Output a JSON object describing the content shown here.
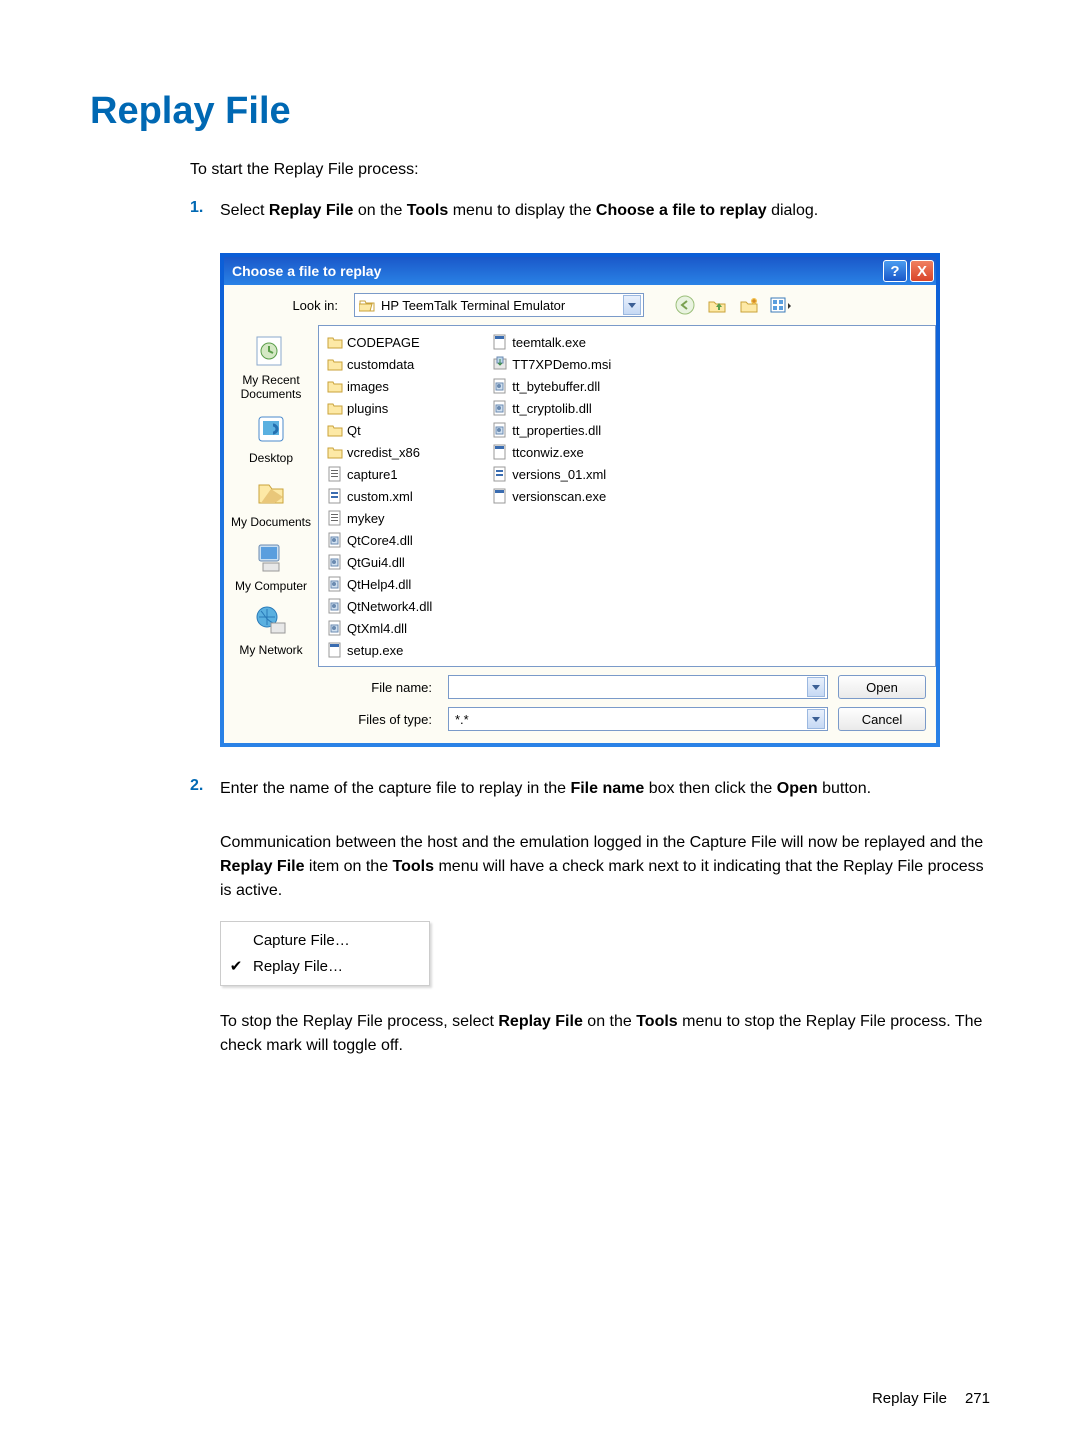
{
  "heading": "Replay File",
  "intro": "To start the Replay File process:",
  "step1": {
    "num": "1.",
    "pre": "Select ",
    "b1": "Replay File",
    "mid1": " on the ",
    "b2": "Tools",
    "mid2": " menu to display the ",
    "b3": "Choose a file to replay",
    "post": " dialog."
  },
  "dialog": {
    "title": "Choose a file to replay",
    "help": "?",
    "close": "X",
    "lookin_label": "Look in:",
    "lookin_value": "HP TeemTalk Terminal Emulator",
    "places": {
      "recent": "My Recent Documents",
      "desktop": "Desktop",
      "mydocs": "My Documents",
      "mycomputer": "My Computer",
      "mynetwork": "My Network"
    },
    "files_col1": [
      {
        "t": "folder",
        "n": "CODEPAGE"
      },
      {
        "t": "folder",
        "n": "customdata"
      },
      {
        "t": "folder",
        "n": "images"
      },
      {
        "t": "folder",
        "n": "plugins"
      },
      {
        "t": "folder",
        "n": "Qt"
      },
      {
        "t": "folder",
        "n": "vcredist_x86"
      },
      {
        "t": "file",
        "n": "capture1"
      },
      {
        "t": "xml",
        "n": "custom.xml"
      },
      {
        "t": "file",
        "n": "mykey"
      },
      {
        "t": "dll",
        "n": "QtCore4.dll"
      },
      {
        "t": "dll",
        "n": "QtGui4.dll"
      },
      {
        "t": "dll",
        "n": "QtHelp4.dll"
      },
      {
        "t": "dll",
        "n": "QtNetwork4.dll"
      },
      {
        "t": "dll",
        "n": "QtXml4.dll"
      },
      {
        "t": "exe",
        "n": "setup.exe"
      }
    ],
    "files_col2": [
      {
        "t": "exe",
        "n": "teemtalk.exe"
      },
      {
        "t": "msi",
        "n": "TT7XPDemo.msi"
      },
      {
        "t": "dll",
        "n": "tt_bytebuffer.dll"
      },
      {
        "t": "dll",
        "n": "tt_cryptolib.dll"
      },
      {
        "t": "dll",
        "n": "tt_properties.dll"
      },
      {
        "t": "exe",
        "n": "ttconwiz.exe"
      },
      {
        "t": "xml",
        "n": "versions_01.xml"
      },
      {
        "t": "exe",
        "n": "versionscan.exe"
      }
    ],
    "filename_label": "File name:",
    "filetype_label": "Files of type:",
    "filetype_value": "*.*",
    "open_btn": "Open",
    "cancel_btn": "Cancel"
  },
  "step2": {
    "num": "2.",
    "pre": "Enter the name of the capture file to replay in the ",
    "b1": "File name",
    "mid": " box then click the ",
    "b2": "Open",
    "post": " button."
  },
  "para2": {
    "pre": "Communication between the host and the emulation logged in the Capture File will now be replayed and the ",
    "b1": "Replay File",
    "mid": " item on the ",
    "b2": "Tools",
    "post": " menu will have a check mark next to it indicating that the Replay File process is active."
  },
  "menu": {
    "item1": "Capture File…",
    "item2": "Replay File…",
    "check": "✔"
  },
  "para3": {
    "pre": "To stop the Replay File process, select ",
    "b1": "Replay File",
    "mid": " on the ",
    "b2": "Tools",
    "post": " menu to stop the Replay File process. The check mark will toggle off."
  },
  "footer": {
    "section": "Replay File",
    "page": "271"
  }
}
